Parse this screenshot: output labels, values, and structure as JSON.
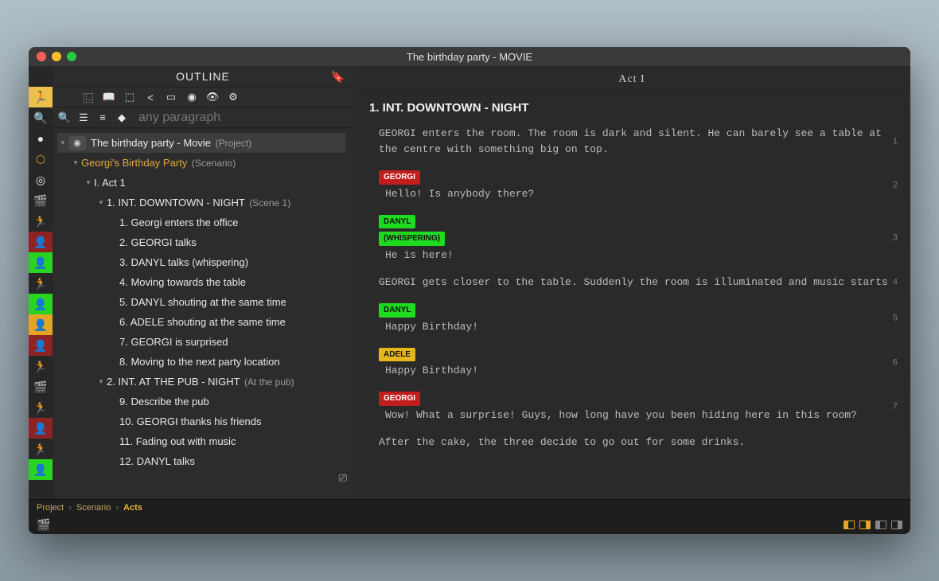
{
  "window_title": "The birthday party - MOVIE",
  "outline_title": "OUTLINE",
  "filter_placeholder": "any paragraph",
  "project_label": "The birthday party - Movie",
  "project_paren": "(Project)",
  "scenario_label": "Georgi's Birthday Party",
  "scenario_paren": "(Scenario)",
  "acts": [
    {
      "label": "I. Act 1",
      "scenes": [
        {
          "label": "1. INT.  DOWNTOWN - NIGHT",
          "paren": "(Scene 1)",
          "beats": [
            "1. Georgi enters the office",
            "2. GEORGI talks",
            "3. DANYL talks (whispering)",
            "4. Moving towards the table",
            "5. DANYL shouting at the same time",
            "6. ADELE shouting at the same time",
            "7. GEORGI is surprised",
            "8. Moving to the next party location"
          ]
        },
        {
          "label": "2. INT.  AT THE PUB - NIGHT",
          "paren": "(At the pub)",
          "beats": [
            "9. Describe the pub",
            "10. GEORGI thanks his friends",
            "11. Fading out with music",
            "12. DANYL talks"
          ]
        }
      ]
    }
  ],
  "act_header": "Act I",
  "scene_heading": "1. INT.  DOWNTOWN - NIGHT",
  "script": [
    {
      "n": "1",
      "type": "action",
      "text": "GEORGI enters the room. The room is dark and silent. He can barely see a table at the centre with something big on top."
    },
    {
      "n": "2",
      "type": "dialogue",
      "speaker": "GEORGI",
      "color": "red",
      "line": "Hello! Is anybody there?"
    },
    {
      "n": "3",
      "type": "dialogue",
      "speaker": "DANYL",
      "paren": "(WHISPERING)",
      "color": "green",
      "line": "He is here!"
    },
    {
      "n": "4",
      "type": "action",
      "text": "GEORGI gets closer to the table. Suddenly the room is illuminated and music starts"
    },
    {
      "n": "5",
      "type": "dialogue",
      "speaker": "DANYL",
      "color": "green",
      "line": "Happy Birthday!"
    },
    {
      "n": "6",
      "type": "dialogue",
      "speaker": "ADELE",
      "color": "orange",
      "line": "Happy Birthday!"
    },
    {
      "n": "7",
      "type": "dialogue",
      "speaker": "GEORGI",
      "color": "red",
      "line": "Wow! What a surprise! Guys, how long have you been hiding here in this room?"
    },
    {
      "n": "",
      "type": "action",
      "text": "After the cake, the three decide to go out for some drinks."
    }
  ],
  "breadcrumbs": [
    "Project",
    "Scenario",
    "Acts"
  ],
  "sidebar_icons": [
    {
      "glyph": "🏃",
      "name": "actor-icon",
      "cls": "active"
    },
    {
      "glyph": "🔍",
      "name": "search-icon"
    },
    {
      "glyph": "●",
      "name": "dot-icon"
    },
    {
      "glyph": "⬡",
      "name": "box-icon",
      "style": "color:#e3a523"
    },
    {
      "glyph": "◎",
      "name": "target-icon"
    },
    {
      "glyph": "🎬",
      "name": "clapper-icon"
    },
    {
      "glyph": "🏃",
      "name": "actor2-icon"
    },
    {
      "glyph": "👤",
      "name": "speech-red-icon",
      "cls": "red"
    },
    {
      "glyph": "👤",
      "name": "speech-green-icon",
      "cls": "green"
    },
    {
      "glyph": "🏃",
      "name": "actor3-icon"
    },
    {
      "glyph": "👤",
      "name": "speech-green2-icon",
      "cls": "green"
    },
    {
      "glyph": "👤",
      "name": "speech-orange-icon",
      "cls": "orange"
    },
    {
      "glyph": "👤",
      "name": "speech-red2-icon",
      "cls": "red"
    },
    {
      "glyph": "🏃",
      "name": "actor4-icon"
    },
    {
      "glyph": "🎬",
      "name": "clapper2-icon"
    },
    {
      "glyph": "🏃",
      "name": "actor5-icon"
    },
    {
      "glyph": "👤",
      "name": "speech-red3-icon",
      "cls": "red"
    },
    {
      "glyph": "🏃",
      "name": "actor6-icon"
    },
    {
      "glyph": "👤",
      "name": "speech-green3-icon",
      "cls": "green"
    }
  ],
  "toolbar_icons": [
    "tree-icon",
    "book-icon",
    "cube-icon",
    "share-icon",
    "window-icon",
    "record-icon",
    "eye-icon",
    "gear-icon"
  ],
  "toolbar_glyphs": [
    "⿺",
    "📖",
    "⬚",
    "<",
    "▭",
    "◉",
    "👁",
    "⚙"
  ]
}
